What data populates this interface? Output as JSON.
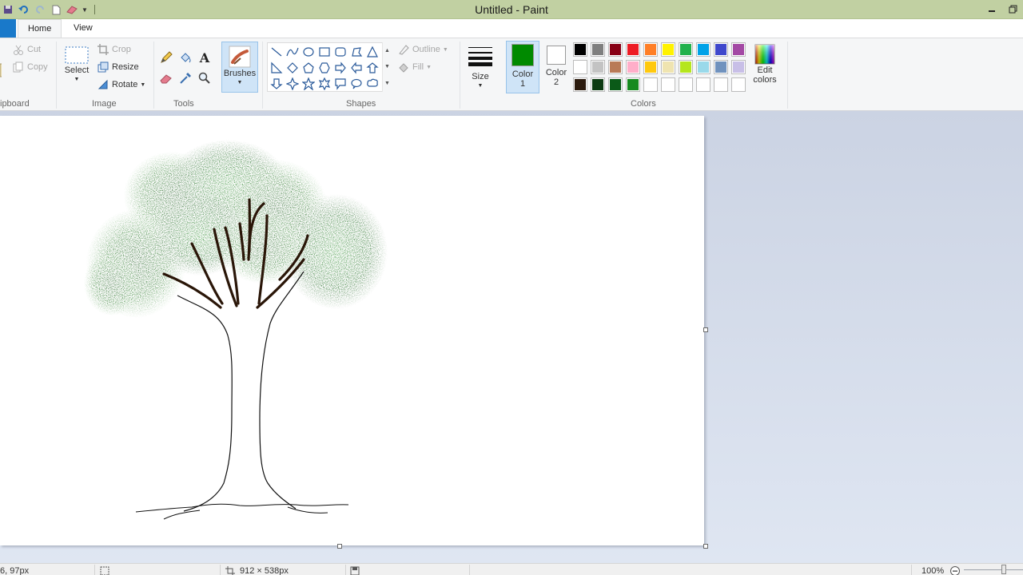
{
  "window": {
    "title": "Untitled - Paint"
  },
  "tabs": {
    "home": "Home",
    "view": "View"
  },
  "ribbon": {
    "clipboard": {
      "label": "ipboard",
      "cut": "Cut",
      "copy": "Copy"
    },
    "image": {
      "label": "Image",
      "select": "Select",
      "crop": "Crop",
      "resize": "Resize",
      "rotate": "Rotate"
    },
    "tools": {
      "label": "Tools"
    },
    "brushes": {
      "label": "Brushes"
    },
    "shapes": {
      "label": "Shapes",
      "outline": "Outline",
      "fill": "Fill"
    },
    "size": {
      "label": "Size"
    },
    "colors": {
      "label": "Colors",
      "color1_line1": "Color",
      "color1_line2": "1",
      "color2_line1": "Color",
      "color2_line2": "2",
      "color1_value": "#008a00",
      "color2_value": "#ffffff",
      "edit_line1": "Edit",
      "edit_line2": "colors",
      "palette": [
        [
          "#000000",
          "#7f7f7f",
          "#880015",
          "#ed1c24",
          "#ff7f27",
          "#fff200",
          "#22b14c",
          "#00a2e8",
          "#3f48cc",
          "#a349a4"
        ],
        [
          "#ffffff",
          "#c3c3c3",
          "#b97a57",
          "#ffaec9",
          "#ffc90e",
          "#efe4b0",
          "#b5e61d",
          "#99d9ea",
          "#7092be",
          "#c8bfe7"
        ],
        [
          "#2b1b0e",
          "#0c3a12",
          "#0b5a18",
          "#168a1e",
          "#ffffff",
          "#ffffff",
          "#ffffff",
          "#ffffff",
          "#ffffff",
          "#ffffff"
        ]
      ]
    }
  },
  "statusbar": {
    "cursor_pos": "6, 97px",
    "image_size": "912 × 538px",
    "zoom": "100%"
  }
}
